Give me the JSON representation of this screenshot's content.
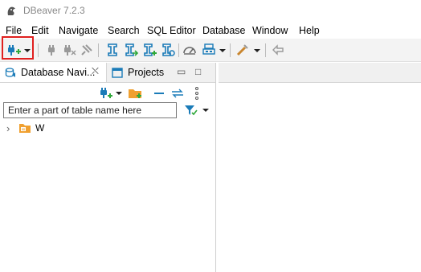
{
  "window": {
    "title": "DBeaver 7.2.3"
  },
  "menu": [
    "File",
    "Edit",
    "Navigate",
    "Search",
    "SQL Editor",
    "Database",
    "Window",
    "Help"
  ],
  "toolbar": {
    "icons": [
      "new-connection-icon",
      "dropdown-arrow-icon",
      "connect-icon",
      "disconnect-icon",
      "disconnect-all-icon",
      "sql-editor-icon",
      "open-sql-script-icon",
      "new-sql-script-icon",
      "recent-sql-script-icon",
      "dashboard-icon",
      "transaction-mode-icon",
      "commit-icon",
      "back-icon"
    ]
  },
  "navigator": {
    "tabs": [
      {
        "label": "Database Navi...",
        "close": "⛌"
      },
      {
        "label": "Projects"
      }
    ],
    "filter_placeholder": "Enter a part of table name here",
    "tree": [
      {
        "label": "W",
        "icon": "database-folder-icon"
      }
    ]
  },
  "colors": {
    "highlight": "#e0201f",
    "accent": "#1a7bb8",
    "green": "#2fa83a",
    "folder": "#f0a030"
  }
}
